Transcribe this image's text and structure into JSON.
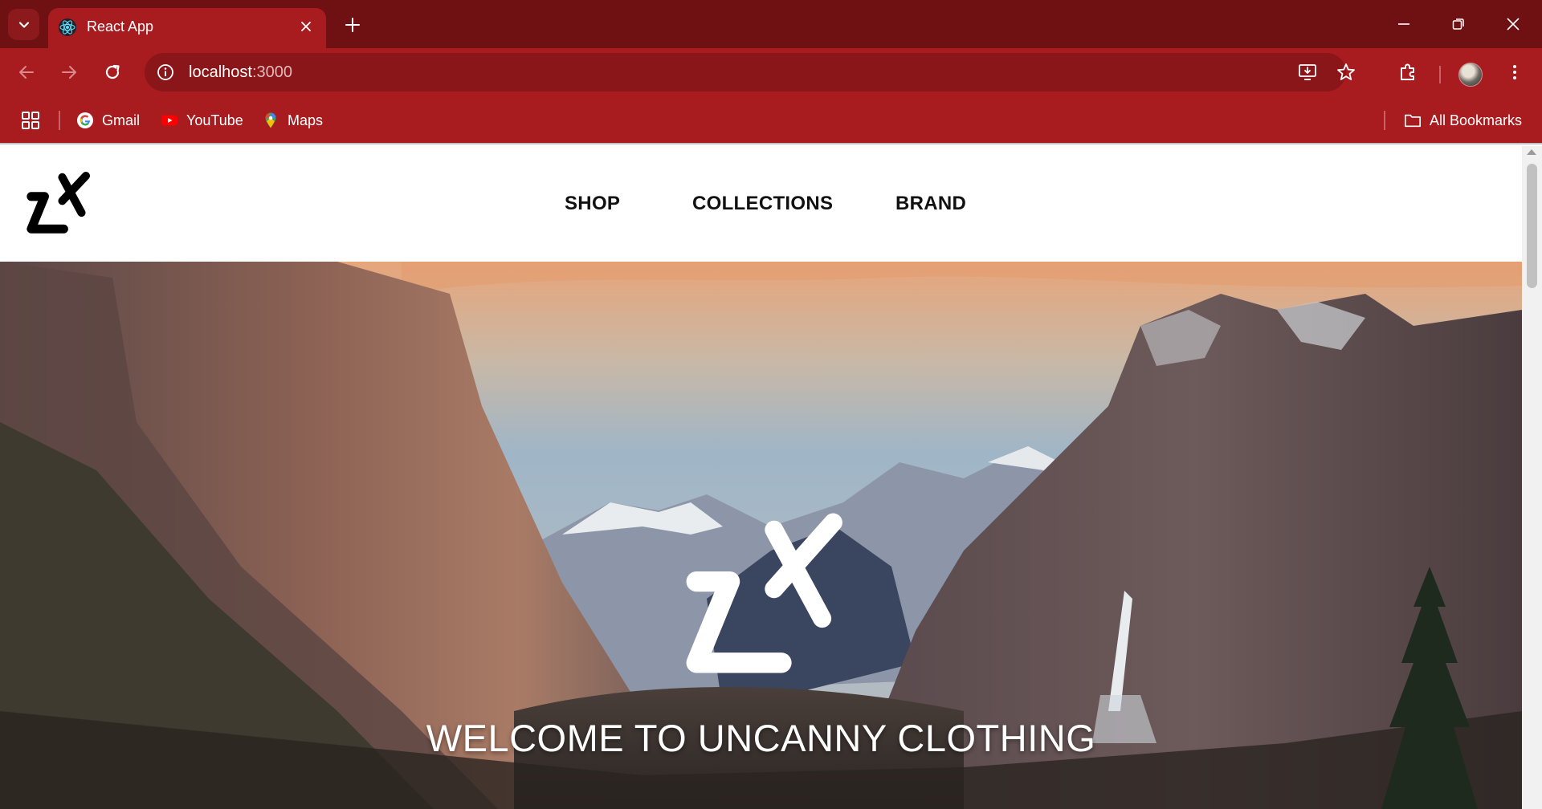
{
  "browser": {
    "tab_title": "React App",
    "url_host": "localhost",
    "url_port": ":3000",
    "bookmarks": [
      {
        "label": "Gmail",
        "icon": "google-icon"
      },
      {
        "label": "YouTube",
        "icon": "youtube-icon"
      },
      {
        "label": "Maps",
        "icon": "maps-icon"
      }
    ],
    "all_bookmarks_label": "All Bookmarks",
    "colors": {
      "frame": "#6f1113",
      "toolbar": "#a81c20",
      "omnibox": "#8a1619"
    }
  },
  "site": {
    "nav": [
      {
        "label": "SHOP"
      },
      {
        "label": "COLLECTIONS"
      },
      {
        "label": "BRAND"
      }
    ],
    "hero_title": "WELCOME TO UNCANNY CLOTHING"
  }
}
